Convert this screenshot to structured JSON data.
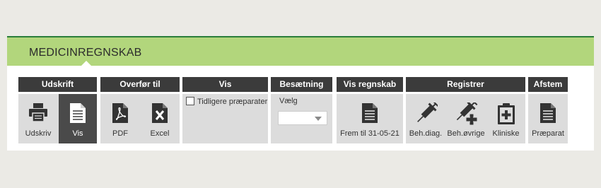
{
  "module": {
    "title": "MEDICINREGNSKAB"
  },
  "groups": {
    "udskrift": {
      "title": "Udskrift",
      "udskriv_label": "Udskriv",
      "vis_label": "Vis"
    },
    "overfoer": {
      "title": "Overfør til",
      "pdf_label": "PDF",
      "excel_label": "Excel"
    },
    "vis": {
      "title": "Vis",
      "checkbox_label": "Tidligere præparater",
      "checkbox_checked": false
    },
    "besaetning": {
      "title": "Besætning",
      "select_label": "Vælg",
      "select_value": ""
    },
    "vis_regnskab": {
      "title": "Vis regnskab",
      "button_label": "Frem til 31-05-21"
    },
    "registrer": {
      "title": "Registrer",
      "beh_diag_label": "Beh.diag.",
      "beh_oevrige_label": "Beh.øvrige",
      "kliniske_label": "Kliniske"
    },
    "afstem": {
      "title": "Afstem",
      "praeparat_label": "Præparat"
    }
  },
  "colors": {
    "header_green": "#b2d67c",
    "header_border": "#2a7d3a",
    "group_header": "#3b3b3b",
    "group_body": "#dcdcdc",
    "active_button": "#4a4a4a",
    "icon_dark": "#333333"
  },
  "icons": {
    "udskriv": "printer-icon",
    "vis": "document-icon",
    "pdf": "pdf-icon",
    "excel": "excel-icon",
    "frem_til": "document-icon",
    "beh_diag": "syringe-icon",
    "beh_oevrige": "syringe-cross-icon",
    "kliniske": "clipboard-medical-icon",
    "praeparat": "document-icon"
  }
}
